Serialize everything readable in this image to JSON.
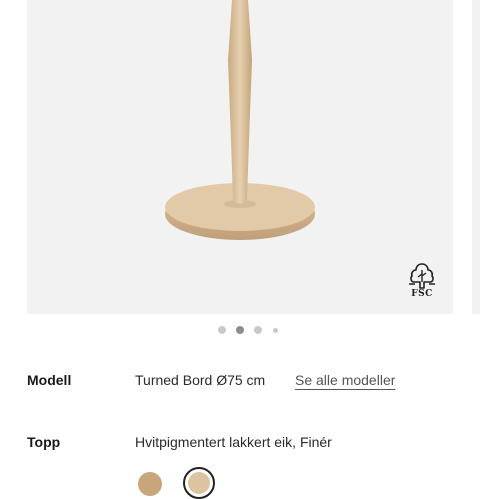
{
  "gallery": {
    "image_icon": "table-product-image",
    "badge": {
      "icon": "fsc-tree-icon",
      "label": "FSC"
    },
    "pagination": {
      "count": 4,
      "active_index": 1
    }
  },
  "model": {
    "label": "Modell",
    "value": "Turned Bord Ø75 cm",
    "link": "Se alle modeller"
  },
  "top": {
    "label": "Topp",
    "value": "Hvitpigmentert lakkert eik, Finér",
    "swatches": [
      {
        "name": "oak",
        "color": "#c9a57c",
        "selected": false
      },
      {
        "name": "white-pigmented-oak",
        "color": "#dcc4a2",
        "selected": true
      }
    ]
  },
  "colors": {
    "wood_light": "#dfc7a6",
    "wood_mid": "#cfb28a",
    "wood_dark": "#b8976c",
    "background": "#f2f2f2"
  }
}
